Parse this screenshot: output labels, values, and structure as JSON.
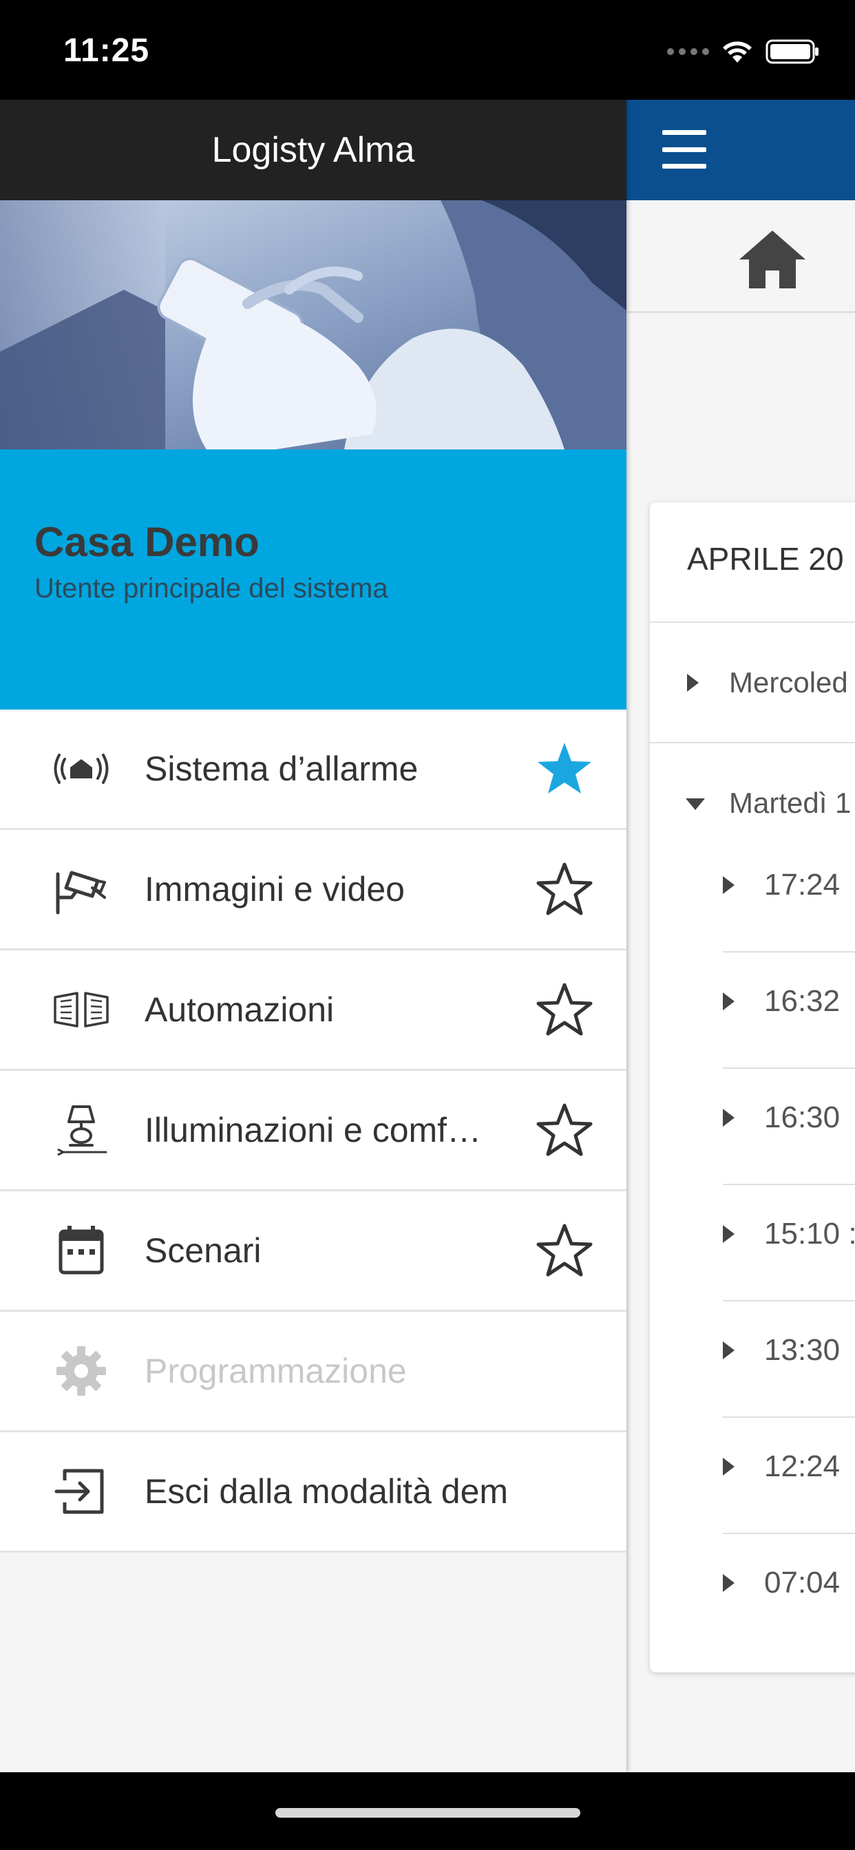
{
  "status_bar": {
    "time": "11:25"
  },
  "app": {
    "title": "Logisty Alma",
    "colors": {
      "header_dark": "#222222",
      "topbar_blue": "#0a4f8f",
      "profile_cyan": "#00a6df",
      "star_active": "#1aa7e0"
    }
  },
  "profile": {
    "name": "Casa Demo",
    "subtitle": "Utente principale del sistema"
  },
  "menu": {
    "items": [
      {
        "label": "Sistema d’allarme",
        "icon": "alarm-siren-icon",
        "favorite": true,
        "enabled": true
      },
      {
        "label": "Immagini e video",
        "icon": "security-camera-icon",
        "favorite": false,
        "enabled": true
      },
      {
        "label": "Automazioni",
        "icon": "shutters-icon",
        "favorite": false,
        "enabled": true
      },
      {
        "label": "Illuminazioni e comf…",
        "icon": "lamp-icon",
        "favorite": false,
        "enabled": true
      },
      {
        "label": "Scenari",
        "icon": "calendar-icon",
        "favorite": false,
        "enabled": true
      },
      {
        "label": "Programmazione",
        "icon": "gear-icon",
        "favorite": null,
        "enabled": false
      },
      {
        "label": "Esci dalla modalità demo",
        "icon": "exit-icon",
        "favorite": null,
        "enabled": true
      }
    ]
  },
  "background": {
    "month": "APRILE 20",
    "days": [
      {
        "label": "Mercoled",
        "expanded": false
      },
      {
        "label": "Martedì 1",
        "expanded": true
      }
    ],
    "events": [
      {
        "time": "17:24"
      },
      {
        "time": "16:32"
      },
      {
        "time": "16:30"
      },
      {
        "time": "15:10 :"
      },
      {
        "time": "13:30"
      },
      {
        "time": "12:24"
      },
      {
        "time": "07:04"
      }
    ]
  }
}
